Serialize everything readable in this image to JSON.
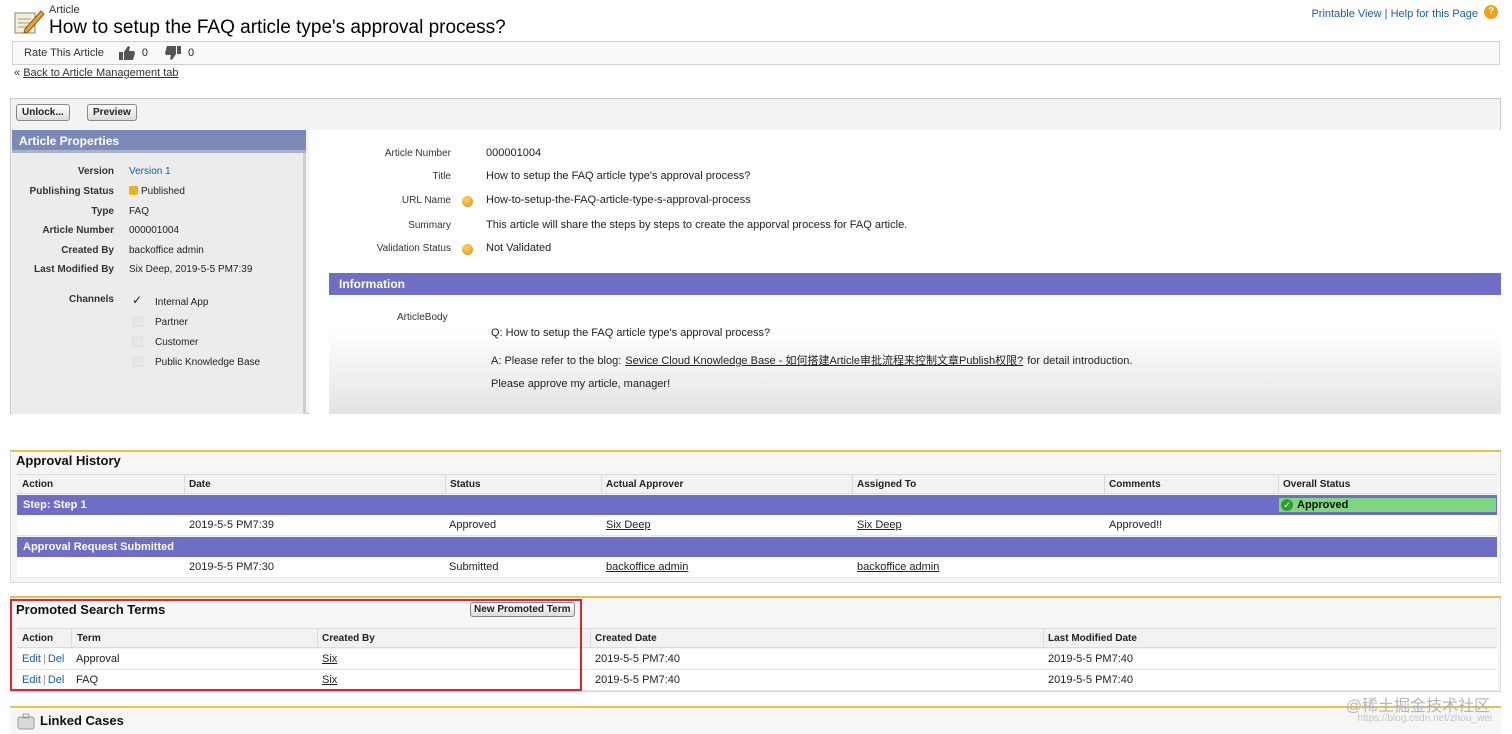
{
  "header": {
    "kicker": "Article",
    "title": "How to setup the FAQ article type's approval process?",
    "printable_view": "Printable View",
    "link_sep": "|",
    "help_link": "Help for this Page",
    "help_glyph": "?"
  },
  "rating": {
    "label": "Rate This Article",
    "up_count": "0",
    "down_count": "0"
  },
  "back_link": {
    "prefix": "«",
    "label": "Back to Article Management tab"
  },
  "buttons": {
    "unlock": "Unlock...",
    "preview": "Preview"
  },
  "properties": {
    "title": "Article Properties",
    "rows": [
      {
        "label": "Version",
        "value": "Version 1"
      },
      {
        "label": "Publishing Status",
        "value": "Published"
      },
      {
        "label": "Type",
        "value": "FAQ"
      },
      {
        "label": "Article Number",
        "value": "000001004"
      },
      {
        "label": "Created By",
        "value": "backoffice admin"
      },
      {
        "label": "Last Modified By",
        "value": "Six Deep, 2019-5-5 PM7:39"
      }
    ],
    "channels_label": "Channels",
    "channels": [
      {
        "name": "Internal App",
        "checked": true
      },
      {
        "name": "Partner",
        "checked": false
      },
      {
        "name": "Customer",
        "checked": false
      },
      {
        "name": "Public Knowledge Base",
        "checked": false
      }
    ],
    "check_glyph": "✓"
  },
  "details": {
    "rows": [
      {
        "label": "Article Number",
        "value": "000001004"
      },
      {
        "label": "Title",
        "value": "How to setup the FAQ article type's approval process?"
      },
      {
        "label": "URL Name",
        "value": "How-to-setup-the-FAQ-article-type-s-approval-process"
      },
      {
        "label": "Summary",
        "value": "This article will share the steps by steps to create the apporval process for FAQ article."
      },
      {
        "label": "Validation Status",
        "value": "Not Validated"
      }
    ],
    "info_header": "Information",
    "body_label": "ArticleBody",
    "body_q": "Q: How to setup the FAQ article type's approval process?",
    "body_a_prefix": "A: Please refer to the blog:",
    "body_a_link": "Sevice Cloud Knowledge Base - 如何搭建Article审批流程来控制文章Publish权限?",
    "body_a_suffix": "for detail introduction.",
    "body_approve": "Please approve my article, manager!"
  },
  "approval_history": {
    "title": "Approval History",
    "columns": [
      "Action",
      "Date",
      "Status",
      "Actual Approver",
      "Assigned To",
      "Comments",
      "Overall Status"
    ],
    "step1_label": "Step: Step 1",
    "overall_status": "Approved",
    "ok_glyph": "✓",
    "step1_row": {
      "date": "2019-5-5 PM7:39",
      "status": "Approved",
      "actual": "Six Deep",
      "assigned": "Six Deep",
      "comments": "Approved!!"
    },
    "submitted_label": "Approval Request Submitted",
    "submitted_row": {
      "date": "2019-5-5 PM7:30",
      "status": "Submitted",
      "actual": "backoffice admin",
      "assigned": "backoffice admin"
    }
  },
  "promoted": {
    "title": "Promoted Search Terms",
    "new_button": "New Promoted Term",
    "columns": [
      "Action",
      "Term",
      "Created By",
      "Created Date",
      "Last Modified Date"
    ],
    "edit": "Edit",
    "del": "Del",
    "action_sep": "|",
    "rows": [
      {
        "term": "Approval",
        "created_by": "Six",
        "created_date": "2019-5-5 PM7:40",
        "modified_date": "2019-5-5 PM7:40"
      },
      {
        "term": "FAQ",
        "created_by": "Six",
        "created_date": "2019-5-5 PM7:40",
        "modified_date": "2019-5-5 PM7:40"
      }
    ]
  },
  "linked_cases": {
    "title": "Linked Cases"
  },
  "watermark": {
    "main": "@稀土掘金技术社区",
    "sub": "https://blog.csdn.net/zhou_wei"
  }
}
